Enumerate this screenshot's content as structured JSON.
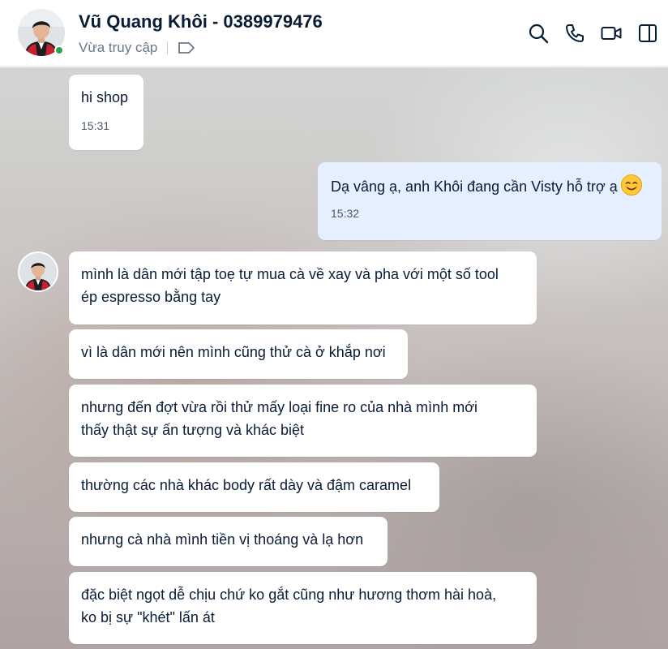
{
  "header": {
    "contact_name": "Vũ Quang Khôi - 0389979476",
    "status": "Vừa truy cập",
    "online": true,
    "icons": [
      "search-icon",
      "phone-icon",
      "video-call-icon",
      "sidebar-toggle-icon"
    ]
  },
  "messages": [
    {
      "direction": "incoming",
      "text": "hi shop",
      "time": "15:31"
    },
    {
      "direction": "outgoing",
      "text": "Dạ vâng ạ, anh Khôi đang cần Visty hỗ trợ ạ",
      "emoji": "smiling-face-icon",
      "time": "15:32"
    },
    {
      "direction": "incoming",
      "lines": [
        "mình là dân mới tập toẹ tự mua cà về xay và pha với một số tool",
        "ép espresso bằng tay"
      ]
    },
    {
      "direction": "incoming",
      "text": "vì là dân mới nên mình cũng thử cà ở khắp nơi"
    },
    {
      "direction": "incoming",
      "lines": [
        "nhưng đến đợt vừa rồi thử mấy loại fine ro của nhà mình mới",
        "thấy thật sự ấn tượng và khác biệt"
      ]
    },
    {
      "direction": "incoming",
      "text": "thường các nhà khác body rất dày và đậm caramel"
    },
    {
      "direction": "incoming",
      "text": "nhưng cà nhà mình tiền vị thoáng và lạ hơn"
    },
    {
      "direction": "incoming",
      "lines": [
        "đặc biệt ngọt dễ chịu chứ ko gắt cũng như hương thơm hài hoà,",
        "ko bị sự \"khét\" lấn át"
      ]
    }
  ],
  "colors": {
    "incoming_bubble": "#ffffff",
    "outgoing_bubble": "#e5efff",
    "text": "#081c36",
    "online_dot": "#30a14e"
  }
}
